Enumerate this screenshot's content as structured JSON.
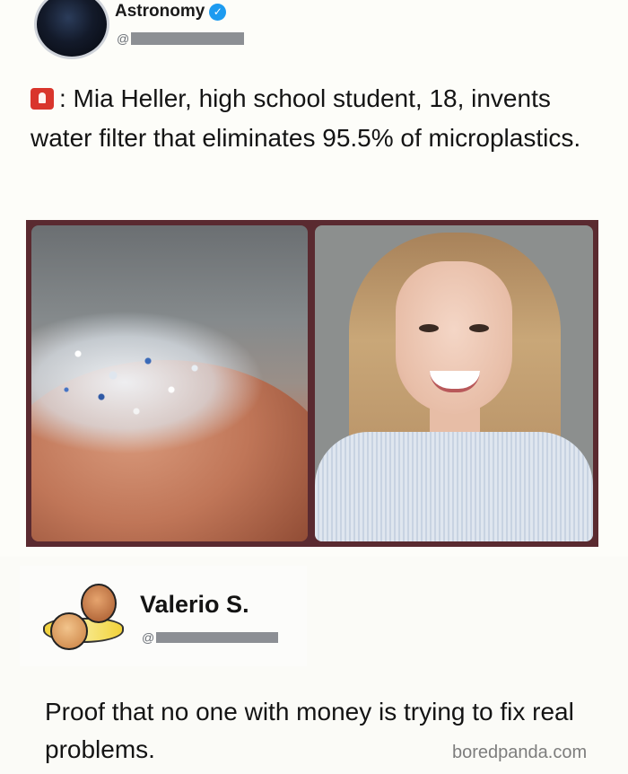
{
  "top_tweet": {
    "account_name": "Astronomy",
    "handle_prefix": "@",
    "text": ": Mia Heller, high school student, 18, invents water filter that eliminates 95.5% of microplastics."
  },
  "reply_tweet": {
    "account_name": "Valerio S.",
    "handle_prefix": "@",
    "text": "Proof that no one with money is trying to fix real problems."
  },
  "watermark": "boredpanda.com",
  "icons": {
    "verified": "verified-badge-icon",
    "alert": "police-siren-emoji-icon"
  },
  "colors": {
    "verified_blue": "#1d9bf0",
    "frame_border": "#5a2a30",
    "siren_red": "#d9352c"
  }
}
